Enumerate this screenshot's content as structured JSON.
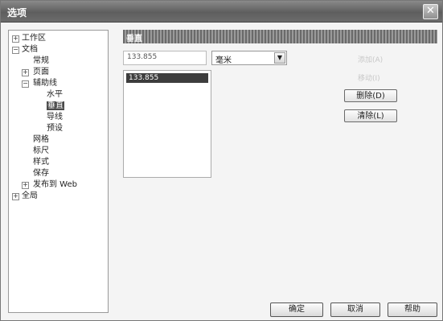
{
  "window": {
    "title": "选项",
    "close_glyph": "✕"
  },
  "tree": {
    "items": [
      {
        "label": "工作区",
        "expander": "+"
      },
      {
        "label": "文档",
        "expander": "−"
      },
      {
        "label": "常规"
      },
      {
        "label": "页面",
        "expander": "+"
      },
      {
        "label": "辅助线",
        "expander": "−"
      },
      {
        "label": "水平"
      },
      {
        "label": "垂直"
      },
      {
        "label": "导线"
      },
      {
        "label": "预设"
      },
      {
        "label": "网格"
      },
      {
        "label": "标尺"
      },
      {
        "label": "样式"
      },
      {
        "label": "保存"
      },
      {
        "label": "发布到 Web",
        "expander": "+"
      },
      {
        "label": "全局",
        "expander": "+"
      }
    ]
  },
  "panel": {
    "header": "垂直",
    "value": "133.855",
    "unit": "毫米",
    "list_items": [
      "133.855"
    ],
    "buttons": {
      "add": "添加(A)",
      "move": "移动(I)",
      "delete": "删除(D)",
      "clear": "清除(L)"
    }
  },
  "footer": {
    "ok": "确定",
    "cancel": "取消",
    "help": "帮助"
  }
}
